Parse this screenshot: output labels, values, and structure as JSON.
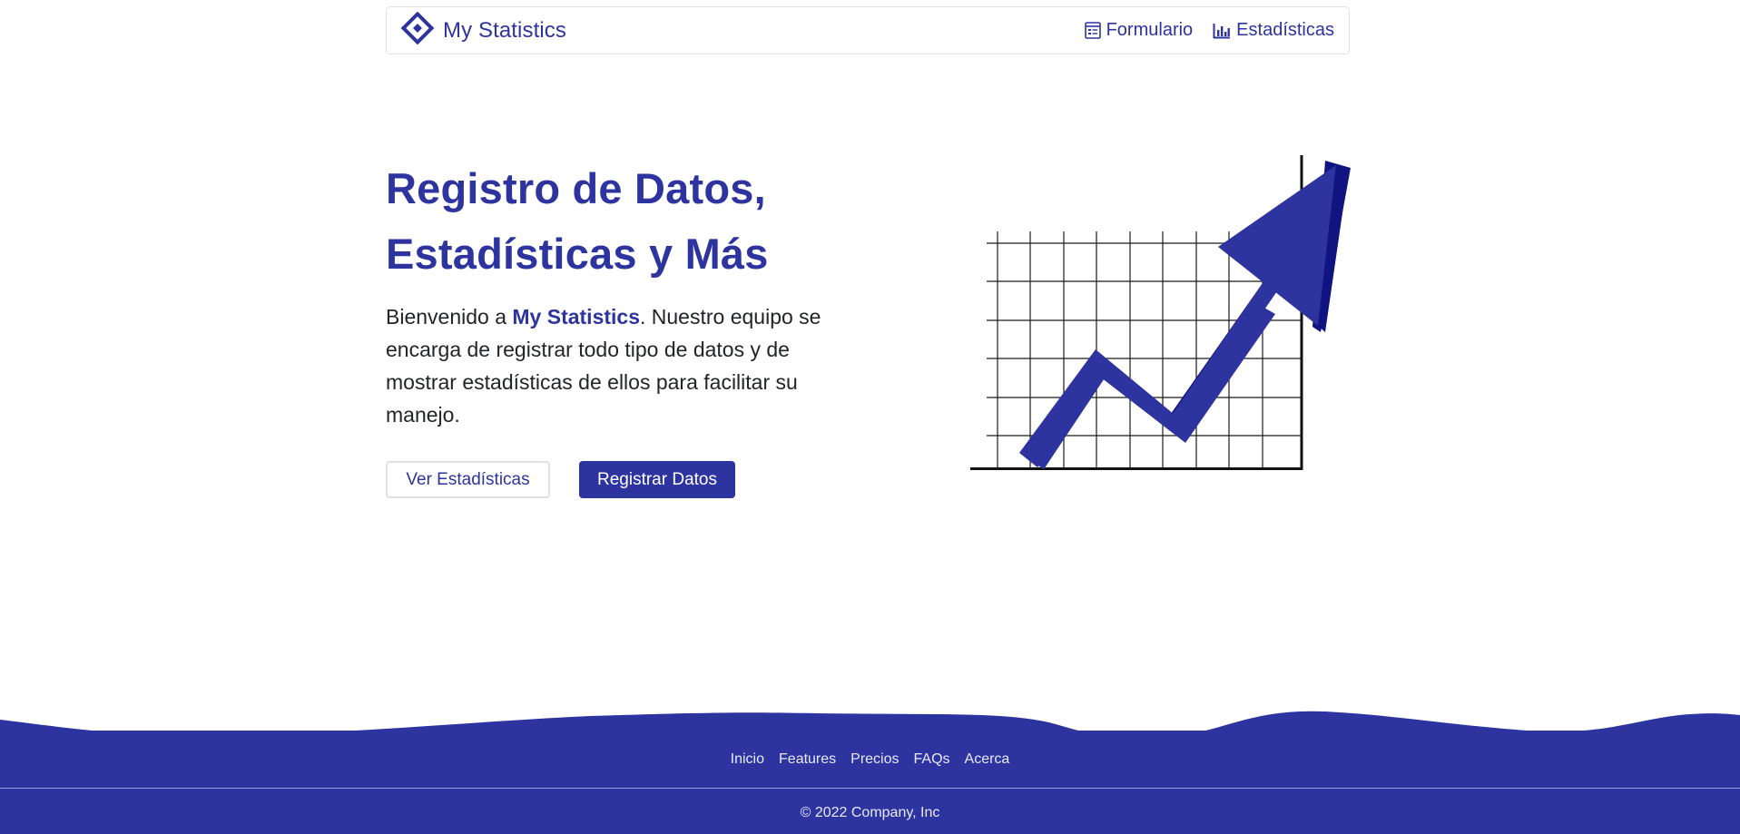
{
  "brand": {
    "name": "My Statistics",
    "logo_icon": "diamond-logo-icon"
  },
  "nav": {
    "items": [
      {
        "label": "Formulario",
        "icon": "form-icon"
      },
      {
        "label": "Estadísticas",
        "icon": "bar-chart-icon"
      }
    ]
  },
  "hero": {
    "title_line1": "Registro de Datos,",
    "title_line2": "Estadísticas y Más",
    "text_prefix": "Bienvenido a ",
    "text_brand": "My Statistics",
    "text_suffix": ". Nuestro equipo se encarga de registrar todo tipo de datos y de mostrar estadísticas de ellos para facilitar su manejo.",
    "btn_secondary": "Ver Estadísticas",
    "btn_primary": "Registrar Datos",
    "illustration_icon": "trend-arrow-chart-icon"
  },
  "footer": {
    "links": [
      "Inicio",
      "Features",
      "Precios",
      "FAQs",
      "Acerca"
    ],
    "copyright": "© 2022 Company, Inc"
  },
  "colors": {
    "primary": "#2d34a0",
    "primary_dark": "#0f1480",
    "text": "#222427",
    "border": "#dfe1e6"
  }
}
